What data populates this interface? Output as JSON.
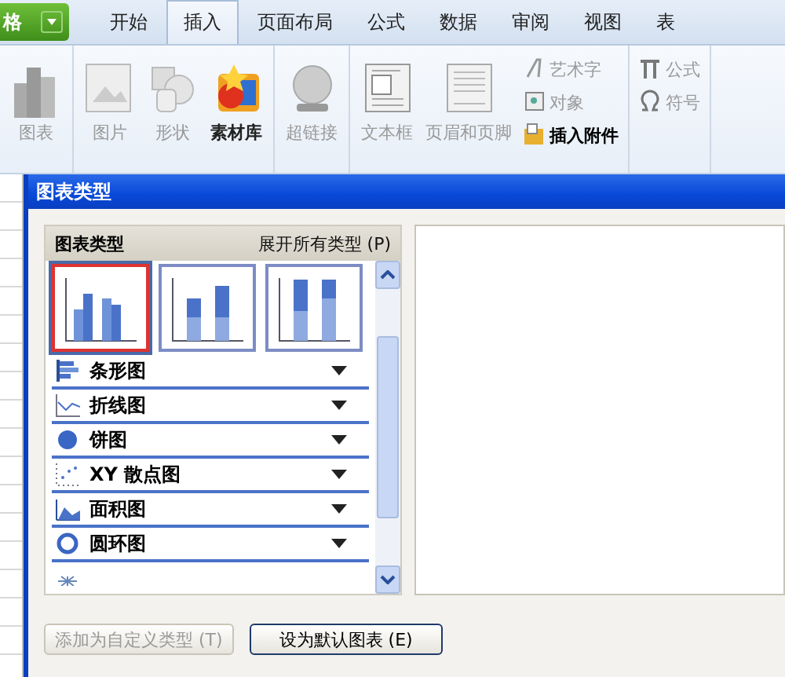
{
  "app_button": {
    "label": "格"
  },
  "tabs": [
    {
      "label": "开始",
      "selected": false
    },
    {
      "label": "插入",
      "selected": true
    },
    {
      "label": "页面布局",
      "selected": false
    },
    {
      "label": "公式",
      "selected": false
    },
    {
      "label": "数据",
      "selected": false
    },
    {
      "label": "审阅",
      "selected": false
    },
    {
      "label": "视图",
      "selected": false
    },
    {
      "label": "表",
      "selected": false
    }
  ],
  "ribbon": {
    "groups": [
      {
        "items": [
          {
            "kind": "large",
            "label": "图表",
            "disabled": true
          }
        ]
      },
      {
        "items": [
          {
            "kind": "large",
            "label": "图片",
            "disabled": true
          },
          {
            "kind": "large",
            "label": "形状",
            "disabled": true
          },
          {
            "kind": "large",
            "label": "素材库",
            "disabled": false
          }
        ]
      },
      {
        "items": [
          {
            "kind": "large",
            "label": "超链接",
            "disabled": true
          }
        ]
      },
      {
        "items": [
          {
            "kind": "large",
            "label": "文本框",
            "disabled": true
          },
          {
            "kind": "large",
            "label": "页眉和页脚",
            "disabled": true
          },
          {
            "kind": "small",
            "label": "艺术字",
            "disabled": true
          },
          {
            "kind": "small",
            "label": "对象",
            "disabled": true
          },
          {
            "kind": "small",
            "label": "插入附件",
            "disabled": false
          }
        ]
      },
      {
        "items": [
          {
            "kind": "small",
            "label": "公式",
            "disabled": true
          },
          {
            "kind": "small",
            "label": "符号",
            "disabled": true
          }
        ]
      }
    ]
  },
  "dialog": {
    "title": "图表类型",
    "panel": {
      "heading": "图表类型",
      "expand_link": "展开所有类型 (P)",
      "subtypes": [
        {
          "selected": true
        },
        {
          "selected": false
        },
        {
          "selected": false
        }
      ],
      "categories": [
        {
          "label": "条形图"
        },
        {
          "label": "折线图"
        },
        {
          "label": "饼图"
        },
        {
          "label": "XY 散点图"
        },
        {
          "label": "面积图"
        },
        {
          "label": "圆环图"
        }
      ]
    },
    "buttons": [
      {
        "label": "添加为自定义类型 (T)",
        "disabled": true
      },
      {
        "label": "设为默认图表 (E)",
        "disabled": false
      }
    ]
  }
}
